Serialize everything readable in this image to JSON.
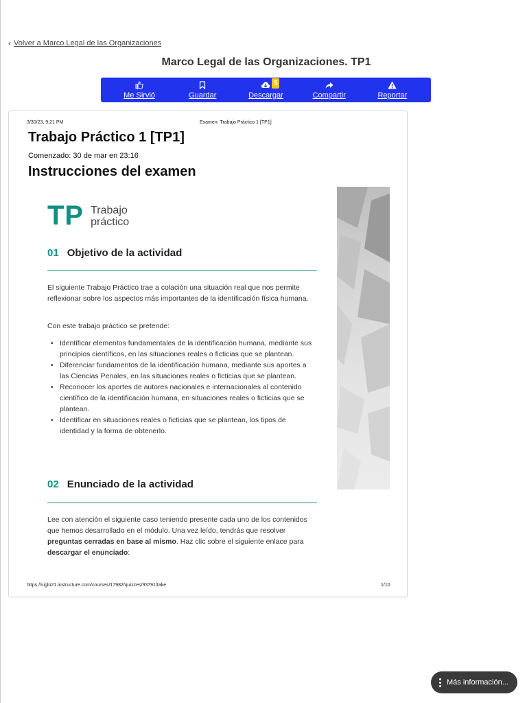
{
  "nav": {
    "back_label": "Volver a Marco Legal de las Organizaciones"
  },
  "document": {
    "title": "Marco Legal de las Organizaciones. TP1"
  },
  "toolbar": {
    "color": "#2233ee",
    "items": [
      {
        "label": "Me Sirvió",
        "icon": "thumbs-up-icon"
      },
      {
        "label": "Guardar",
        "icon": "bookmark-icon"
      },
      {
        "label": "Descargar",
        "icon": "cloud-download-icon",
        "badge": "5"
      },
      {
        "label": "Compartir",
        "icon": "share-icon"
      },
      {
        "label": "Reportar",
        "icon": "warning-icon"
      }
    ]
  },
  "page": {
    "print_date": "3/30/23, 9:21 PM",
    "print_exam": "Examen: Trabajo Práctico 1 [TP1]",
    "heading": "Trabajo Práctico 1 [TP1]",
    "started": "Comenzado: 30 de mar en 23:16",
    "instructions_heading": "Instrucciones del examen",
    "logo": {
      "big": "TP",
      "line1": "Trabajo",
      "line2": "práctico"
    },
    "accent_color": "#109080",
    "section1": {
      "num": "01",
      "title": "Objetivo de la actividad",
      "para1": "El siguiente Trabajo Práctico trae a colación una situación real que nos permite reflexionar sobre los aspectos más importantes de la identificación física humana.",
      "para2": "Con este trabajo práctico se pretende:",
      "bullets": [
        "Identificar elementos fundamentales de la identificación humana, mediante sus principios científicos, en las situaciones reales o ficticias que se plantean.",
        "Diferenciar fundamentos de la identificación humana, mediante sus aportes a las Ciencias Penales, en las situaciones reales o ficticias que se plantean.",
        "Reconocer los aportes de autores nacionales e internacionales al contenido científico de la identificación humana, en situaciones reales o ficticias que se plantean.",
        "Identificar en situaciones reales o ficticias que se plantean, los tipos de identidad y la forma de obtenerlo."
      ]
    },
    "section2": {
      "num": "02",
      "title": "Enunciado de la actividad",
      "p_a": "Lee con atención el siguiente caso teniendo presente cada uno de los contenidos que hemos desarrollado en el módulo. Una vez leído, tendrás que resolver ",
      "p_b": "preguntas cerradas en base al mismo",
      "p_c": ". Haz clic sobre el siguiente enlace para ",
      "p_d": "descargar el enunciado",
      "p_e": ":"
    },
    "footer_url": "https://siglo21.instructure.com/courses/17982/quizzes/93791/take",
    "footer_page": "1/10"
  },
  "more_info": {
    "label": "Más información..."
  }
}
